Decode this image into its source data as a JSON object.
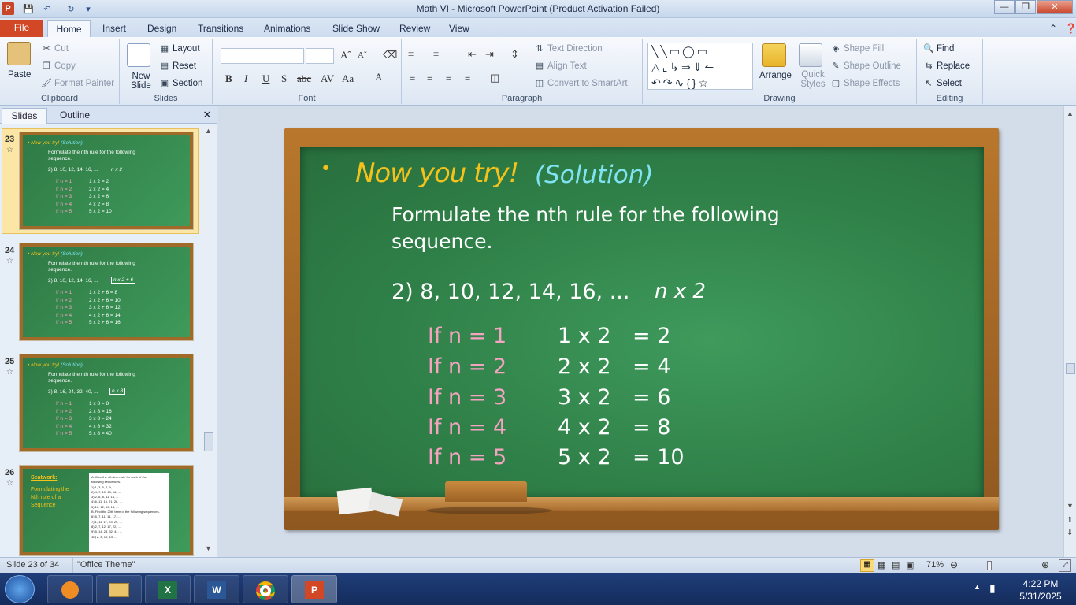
{
  "window": {
    "title": "Math VI - Microsoft PowerPoint (Product Activation Failed)"
  },
  "tabs": [
    "File",
    "Home",
    "Insert",
    "Design",
    "Transitions",
    "Animations",
    "Slide Show",
    "Review",
    "View"
  ],
  "ribbon": {
    "clipboard": {
      "label": "Clipboard",
      "paste": "Paste",
      "cut": "Cut",
      "copy": "Copy",
      "format_painter": "Format Painter"
    },
    "slides": {
      "label": "Slides",
      "new_slide": "New Slide",
      "layout": "Layout",
      "reset": "Reset",
      "section": "Section"
    },
    "font": {
      "label": "Font"
    },
    "paragraph": {
      "label": "Paragraph",
      "text_direction": "Text Direction",
      "align_text": "Align Text",
      "convert": "Convert to SmartArt"
    },
    "drawing": {
      "label": "Drawing",
      "arrange": "Arrange",
      "quick_styles": "Quick Styles",
      "shape_fill": "Shape Fill",
      "shape_outline": "Shape Outline",
      "shape_effects": "Shape Effects"
    },
    "editing": {
      "label": "Editing",
      "find": "Find",
      "replace": "Replace",
      "select": "Select"
    }
  },
  "pane": {
    "tab_slides": "Slides",
    "tab_outline": "Outline"
  },
  "thumbnails": [
    {
      "num": "23",
      "title": "Now you try!",
      "subtitle": "(Solution)",
      "line1": "Formulate the nth rule for the following",
      "line2": "sequence.",
      "seq": "2)  8, 10, 12, 14, 16, ...",
      "rule": "n x 2",
      "rows": [
        [
          "If n = 1",
          "1 x 2   = 2"
        ],
        [
          "If n = 2",
          "2 x 2   = 4"
        ],
        [
          "If n = 3",
          "3 x 2   = 6"
        ],
        [
          "If n = 4",
          "4 x 2   = 8"
        ],
        [
          "If n = 5",
          "5 x 2   = 10"
        ]
      ]
    },
    {
      "num": "24",
      "title": "Now you try!",
      "subtitle": "(Solution)",
      "line1": "Formulate the nth rule for the following",
      "line2": "sequence.",
      "seq": "2)  8, 10, 12, 14, 16, ...",
      "rule": "n x 2 + 6",
      "rows": [
        [
          "If n = 1",
          "1 x 2 + 6   = 8"
        ],
        [
          "If n = 2",
          "2 x 2 + 6   = 10"
        ],
        [
          "If n = 3",
          "3 x 2 + 6   = 12"
        ],
        [
          "If n = 4",
          "4 x 2 + 6   = 14"
        ],
        [
          "If n = 5",
          "5 x 2 + 6   = 16"
        ]
      ]
    },
    {
      "num": "25",
      "title": "Now you try!",
      "subtitle": "(Solution)",
      "line1": "Formulate the nth rule for the following",
      "line2": "sequence.",
      "seq": "3)  8, 16, 24, 32, 40, ...",
      "rule": "n x 8",
      "rows": [
        [
          "If n = 1",
          "1 x 8   = 8"
        ],
        [
          "If n = 2",
          "2 x 8   = 16"
        ],
        [
          "If n = 3",
          "3 x 8   = 24"
        ],
        [
          "If n = 4",
          "4 x 8   = 32"
        ],
        [
          "If n = 5",
          "5 x 8   = 40"
        ]
      ]
    },
    {
      "num": "26",
      "heading": "Seatwork:",
      "body": [
        "Formulating the",
        "Nth rule of a",
        "Sequence"
      ],
      "paper": [
        "A. Give the nth term rule for each of the",
        "following sequences.",
        "1) 1, 3, 5, 7, 9, ...",
        "2) 4, 7, 10, 13, 16, ...",
        "3) 2, 6, 8, 11, 14, ...",
        "4) 6, 11, 16, 21, 26, ...",
        "5) 10, 12, 13, 14, ...",
        "B. Find the 20th term of the following sequences.",
        "6) 5, 7, 11, 14, 17, ...",
        "7) 1, 11, 17, 23, 29, ...",
        "8) 2, 7, 12, 17, 22, ...",
        "9) 5, 14, 23, 32, 41, ...",
        "10) 2, 4, 10, 14, ..."
      ]
    }
  ],
  "slide": {
    "bullet": "•",
    "title": "Now you try!",
    "subtitle": "(Solution)",
    "instruction_line1": "Formulate the nth rule for the following",
    "instruction_line2": "sequence.",
    "sequence": "2)  8, 10, 12, 14, 16, ...",
    "rule": "n x 2",
    "rows": [
      {
        "cond": "If n = 1",
        "expr": "1 x 2",
        "result": "= 2"
      },
      {
        "cond": "If n = 2",
        "expr": "2 x 2",
        "result": "= 4"
      },
      {
        "cond": "If n = 3",
        "expr": "3 x 2",
        "result": "= 6"
      },
      {
        "cond": "If n = 4",
        "expr": "4 x 2",
        "result": "= 8"
      },
      {
        "cond": "If n = 5",
        "expr": "5 x 2",
        "result": "= 10"
      }
    ]
  },
  "status": {
    "slide_count": "Slide 23 of 34",
    "theme": "\"Office Theme\"",
    "zoom": "71%",
    "zoom_level": 0.71
  },
  "taskbar": {
    "time": "4:22 PM",
    "date": "5/31/2025"
  },
  "colors": {
    "title": "#f5c21b",
    "subtitle": "#7fe3f2",
    "text": "#ffffff",
    "cond": "#f6a3c2",
    "board": "#2f8048",
    "frame": "#a9692a"
  }
}
